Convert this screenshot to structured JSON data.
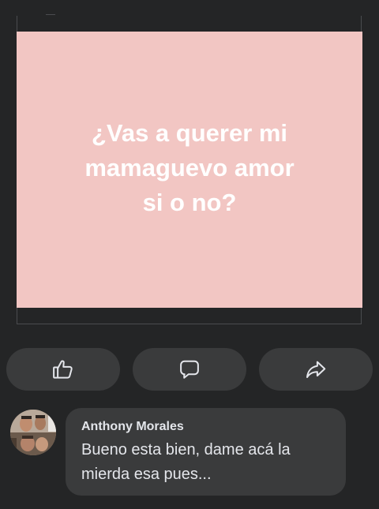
{
  "post": {
    "image_background": "#f2c6c3",
    "text_lines": [
      "¿Vas a querer mi",
      "mamaguevo amor",
      "si o no?"
    ]
  },
  "actions": [
    {
      "icon": "like-icon"
    },
    {
      "icon": "comment-icon"
    },
    {
      "icon": "share-icon"
    }
  ],
  "comment": {
    "author": "Anthony Morales",
    "text": "Bueno esta bien, dame acá la mierda esa pues..."
  },
  "colors": {
    "background": "#242526",
    "button": "#3a3b3c",
    "text": "#e4e6eb"
  }
}
